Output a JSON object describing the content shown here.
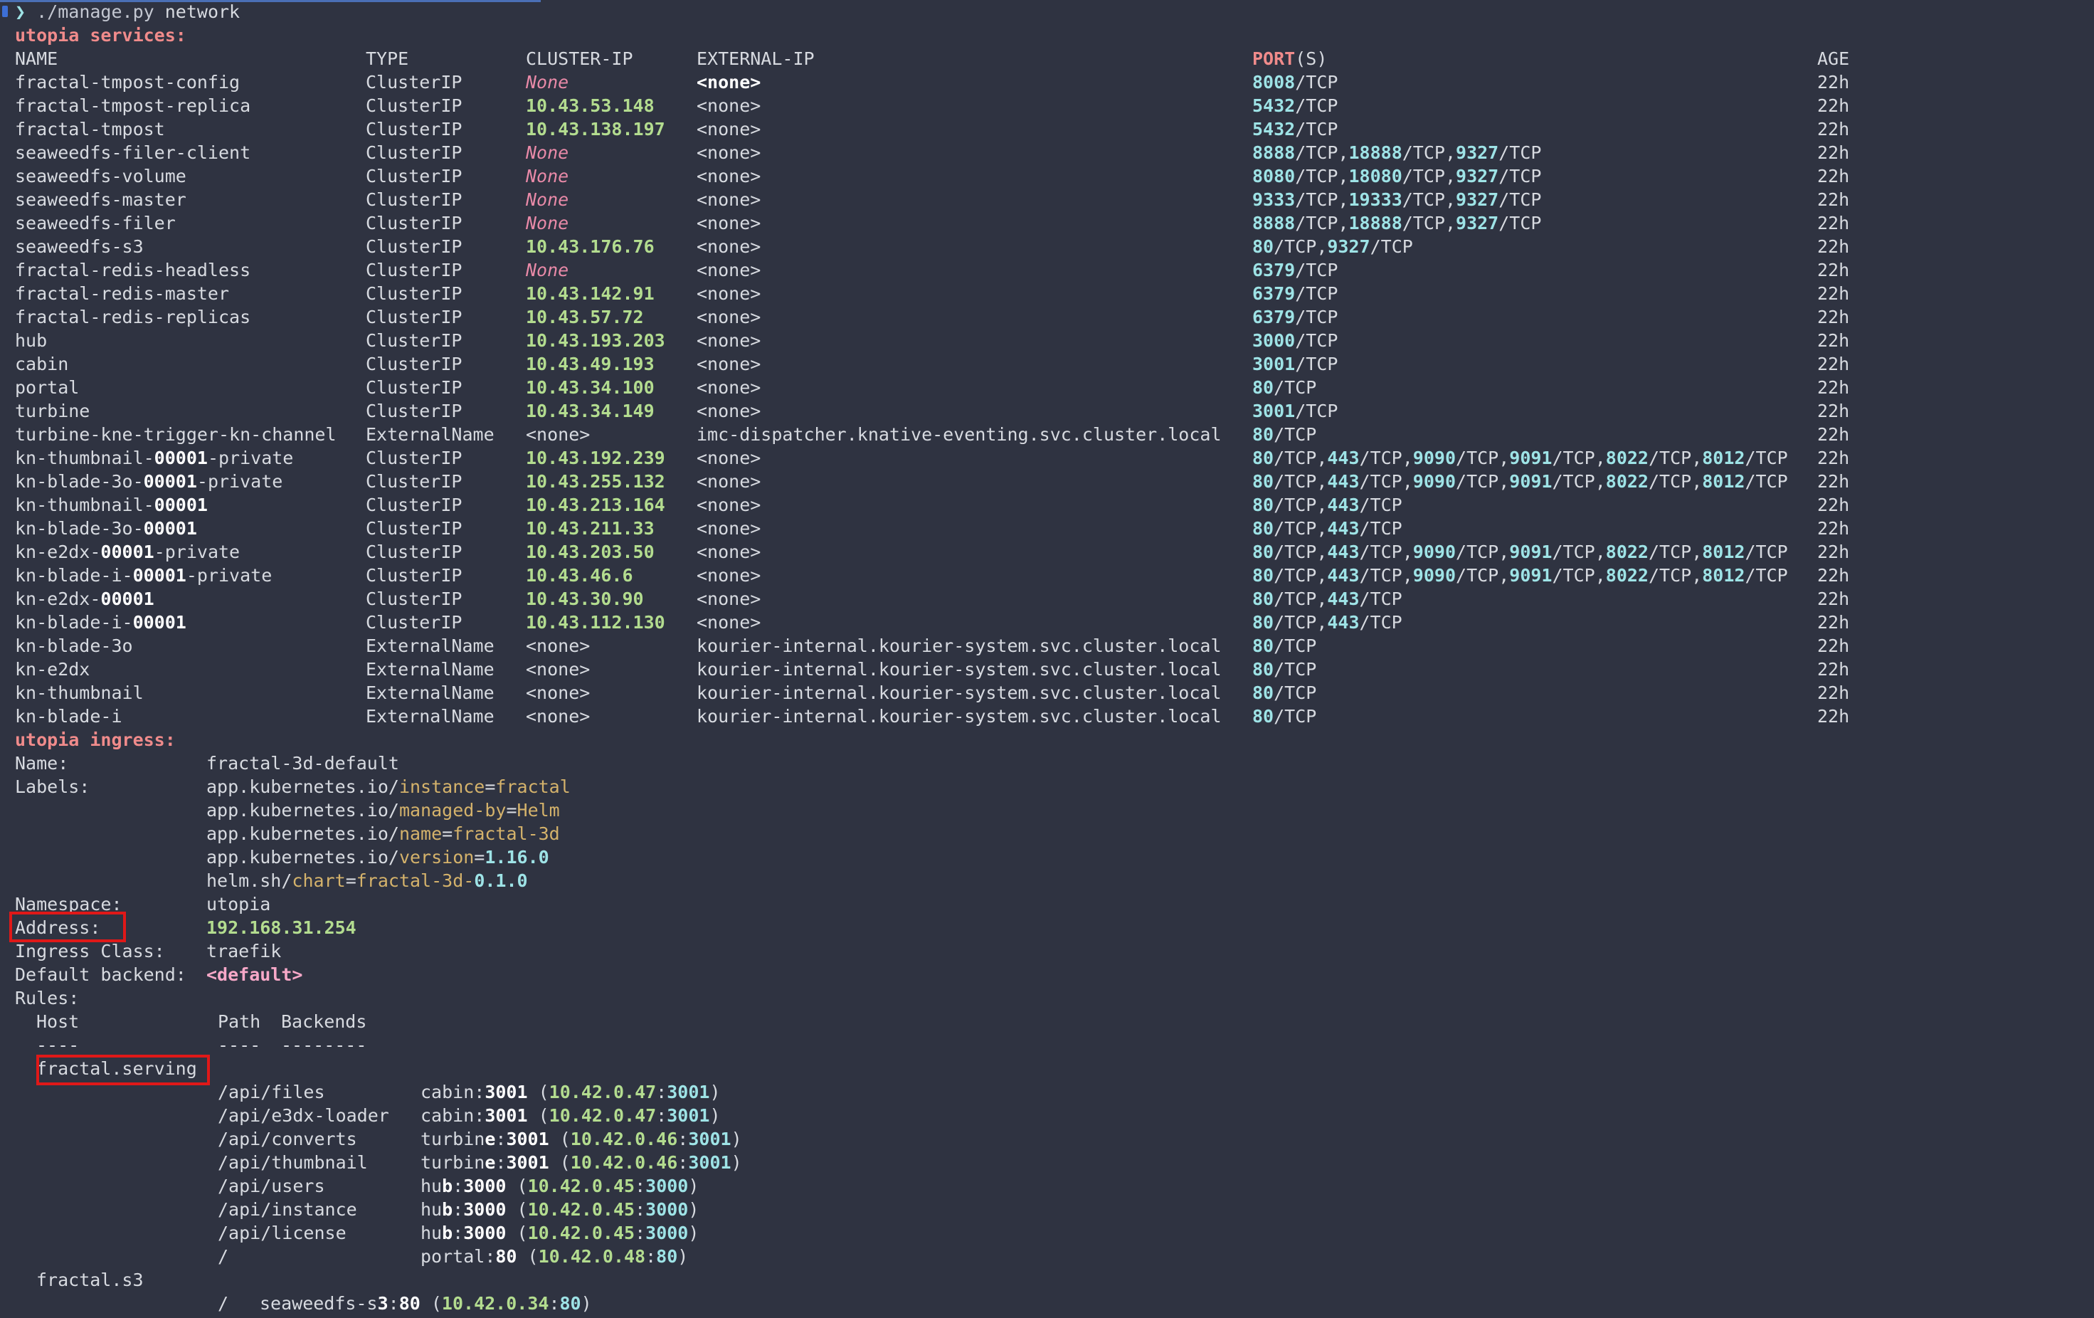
{
  "prompt": {
    "symbol": "❯",
    "command": "./manage.py",
    "arg": "network"
  },
  "services": {
    "title": "utopia services:",
    "headers": {
      "name": "NAME",
      "type": "TYPE",
      "cluster_ip": "CLUSTER-IP",
      "external_ip": "EXTERNAL-IP",
      "ports_bold": "PORT",
      "ports_rest": "(S)",
      "age": "AGE"
    },
    "rows": [
      {
        "name": "fractal-tmpost-config",
        "type": "ClusterIP",
        "cluster_ip": "None",
        "external_ip": "<none>",
        "ports": "8008/TCP",
        "age": "22h"
      },
      {
        "name": "fractal-tmpost-replica",
        "type": "ClusterIP",
        "cluster_ip": "10.43.53.148",
        "external_ip": "<none>",
        "ports": "5432/TCP",
        "age": "22h"
      },
      {
        "name": "fractal-tmpost",
        "type": "ClusterIP",
        "cluster_ip": "10.43.138.197",
        "external_ip": "<none>",
        "ports": "5432/TCP",
        "age": "22h"
      },
      {
        "name": "seaweedfs-filer-client",
        "type": "ClusterIP",
        "cluster_ip": "None",
        "external_ip": "<none>",
        "ports": "8888/TCP,18888/TCP,9327/TCP",
        "age": "22h"
      },
      {
        "name": "seaweedfs-volume",
        "type": "ClusterIP",
        "cluster_ip": "None",
        "external_ip": "<none>",
        "ports": "8080/TCP,18080/TCP,9327/TCP",
        "age": "22h"
      },
      {
        "name": "seaweedfs-master",
        "type": "ClusterIP",
        "cluster_ip": "None",
        "external_ip": "<none>",
        "ports": "9333/TCP,19333/TCP,9327/TCP",
        "age": "22h"
      },
      {
        "name": "seaweedfs-filer",
        "type": "ClusterIP",
        "cluster_ip": "None",
        "external_ip": "<none>",
        "ports": "8888/TCP,18888/TCP,9327/TCP",
        "age": "22h"
      },
      {
        "name": "seaweedfs-s3",
        "type": "ClusterIP",
        "cluster_ip": "10.43.176.76",
        "external_ip": "<none>",
        "ports": "80/TCP,9327/TCP",
        "age": "22h"
      },
      {
        "name": "fractal-redis-headless",
        "type": "ClusterIP",
        "cluster_ip": "None",
        "external_ip": "<none>",
        "ports": "6379/TCP",
        "age": "22h"
      },
      {
        "name": "fractal-redis-master",
        "type": "ClusterIP",
        "cluster_ip": "10.43.142.91",
        "external_ip": "<none>",
        "ports": "6379/TCP",
        "age": "22h"
      },
      {
        "name": "fractal-redis-replicas",
        "type": "ClusterIP",
        "cluster_ip": "10.43.57.72",
        "external_ip": "<none>",
        "ports": "6379/TCP",
        "age": "22h"
      },
      {
        "name": "hub",
        "type": "ClusterIP",
        "cluster_ip": "10.43.193.203",
        "external_ip": "<none>",
        "ports": "3000/TCP",
        "age": "22h"
      },
      {
        "name": "cabin",
        "type": "ClusterIP",
        "cluster_ip": "10.43.49.193",
        "external_ip": "<none>",
        "ports": "3001/TCP",
        "age": "22h"
      },
      {
        "name": "portal",
        "type": "ClusterIP",
        "cluster_ip": "10.43.34.100",
        "external_ip": "<none>",
        "ports": "80/TCP",
        "age": "22h"
      },
      {
        "name": "turbine",
        "type": "ClusterIP",
        "cluster_ip": "10.43.34.149",
        "external_ip": "<none>",
        "ports": "3001/TCP",
        "age": "22h"
      },
      {
        "name": "turbine-kne-trigger-kn-channel",
        "type": "ExternalName",
        "cluster_ip": "<none>",
        "external_ip": "imc-dispatcher.knative-eventing.svc.cluster.local",
        "ports": "80/TCP",
        "age": "22h"
      },
      {
        "name": "kn-thumbnail-00001-private",
        "type": "ClusterIP",
        "cluster_ip": "10.43.192.239",
        "external_ip": "<none>",
        "ports": "80/TCP,443/TCP,9090/TCP,9091/TCP,8022/TCP,8012/TCP",
        "age": "22h"
      },
      {
        "name": "kn-blade-3o-00001-private",
        "type": "ClusterIP",
        "cluster_ip": "10.43.255.132",
        "external_ip": "<none>",
        "ports": "80/TCP,443/TCP,9090/TCP,9091/TCP,8022/TCP,8012/TCP",
        "age": "22h"
      },
      {
        "name": "kn-thumbnail-00001",
        "type": "ClusterIP",
        "cluster_ip": "10.43.213.164",
        "external_ip": "<none>",
        "ports": "80/TCP,443/TCP",
        "age": "22h"
      },
      {
        "name": "kn-blade-3o-00001",
        "type": "ClusterIP",
        "cluster_ip": "10.43.211.33",
        "external_ip": "<none>",
        "ports": "80/TCP,443/TCP",
        "age": "22h"
      },
      {
        "name": "kn-e2dx-00001-private",
        "type": "ClusterIP",
        "cluster_ip": "10.43.203.50",
        "external_ip": "<none>",
        "ports": "80/TCP,443/TCP,9090/TCP,9091/TCP,8022/TCP,8012/TCP",
        "age": "22h"
      },
      {
        "name": "kn-blade-i-00001-private",
        "type": "ClusterIP",
        "cluster_ip": "10.43.46.6",
        "external_ip": "<none>",
        "ports": "80/TCP,443/TCP,9090/TCP,9091/TCP,8022/TCP,8012/TCP",
        "age": "22h"
      },
      {
        "name": "kn-e2dx-00001",
        "type": "ClusterIP",
        "cluster_ip": "10.43.30.90",
        "external_ip": "<none>",
        "ports": "80/TCP,443/TCP",
        "age": "22h"
      },
      {
        "name": "kn-blade-i-00001",
        "type": "ClusterIP",
        "cluster_ip": "10.43.112.130",
        "external_ip": "<none>",
        "ports": "80/TCP,443/TCP",
        "age": "22h"
      },
      {
        "name": "kn-blade-3o",
        "type": "ExternalName",
        "cluster_ip": "<none>",
        "external_ip": "kourier-internal.kourier-system.svc.cluster.local",
        "ports": "80/TCP",
        "age": "22h"
      },
      {
        "name": "kn-e2dx",
        "type": "ExternalName",
        "cluster_ip": "<none>",
        "external_ip": "kourier-internal.kourier-system.svc.cluster.local",
        "ports": "80/TCP",
        "age": "22h"
      },
      {
        "name": "kn-thumbnail",
        "type": "ExternalName",
        "cluster_ip": "<none>",
        "external_ip": "kourier-internal.kourier-system.svc.cluster.local",
        "ports": "80/TCP",
        "age": "22h"
      },
      {
        "name": "kn-blade-i",
        "type": "ExternalName",
        "cluster_ip": "<none>",
        "external_ip": "kourier-internal.kourier-system.svc.cluster.local",
        "ports": "80/TCP",
        "age": "22h"
      }
    ]
  },
  "ingress": {
    "title": "utopia ingress:",
    "name_label": "Name:",
    "name": "fractal-3d-default",
    "labels_label": "Labels:",
    "labels": [
      {
        "prefix": "app.kubernetes.io/",
        "key": "instance",
        "eq": "=",
        "value": "fractal"
      },
      {
        "prefix": "app.kubernetes.io/",
        "key": "managed-by",
        "eq": "=",
        "value": "Helm"
      },
      {
        "prefix": "app.kubernetes.io/",
        "key": "name",
        "eq": "=",
        "value": "fractal-3d"
      },
      {
        "prefix": "app.kubernetes.io/",
        "key": "version",
        "eq": "=",
        "value": "1.16.0"
      },
      {
        "prefix": "helm.sh/",
        "key": "chart",
        "eq": "=",
        "value": "fractal-3d-0.1.0"
      }
    ],
    "namespace_label": "Namespace:",
    "namespace": "utopia",
    "address_label": "Address:",
    "address": "192.168.31.254",
    "class_label": "Ingress Class:",
    "class": "traefik",
    "backend_label": "Default backend:",
    "backend": "<default>",
    "rules_label": "Rules:",
    "rules_headers": {
      "host": "Host",
      "path": "Path",
      "backends": "Backends"
    },
    "rules_dashes": {
      "host": "----",
      "path": "----",
      "backends": "--------"
    },
    "hosts": [
      {
        "host": "fractal.serving",
        "paths": [
          {
            "path": "/api/files",
            "svc": "cabin",
            "port": "3001",
            "ip": "10.42.0.47",
            "ipport": "3001"
          },
          {
            "path": "/api/e3dx-loader",
            "svc": "cabin",
            "port": "3001",
            "ip": "10.42.0.47",
            "ipport": "3001"
          },
          {
            "path": "/api/converts",
            "svc": "turbine",
            "port": "3001",
            "ip": "10.42.0.46",
            "ipport": "3001"
          },
          {
            "path": "/api/thumbnail",
            "svc": "turbine",
            "port": "3001",
            "ip": "10.42.0.46",
            "ipport": "3001"
          },
          {
            "path": "/api/users",
            "svc": "hub",
            "port": "3000",
            "ip": "10.42.0.45",
            "ipport": "3000"
          },
          {
            "path": "/api/instance",
            "svc": "hub",
            "port": "3000",
            "ip": "10.42.0.45",
            "ipport": "3000"
          },
          {
            "path": "/api/license",
            "svc": "hub",
            "port": "3000",
            "ip": "10.42.0.45",
            "ipport": "3000"
          },
          {
            "path": "/",
            "svc": "portal",
            "port": "80",
            "ip": "10.42.0.48",
            "ipport": "80"
          }
        ]
      },
      {
        "host": "fractal.s3",
        "paths": [
          {
            "path": "/",
            "svc": "seaweedfs-s3",
            "port": "80",
            "ip": "10.42.0.34",
            "ipport": "80"
          }
        ]
      }
    ]
  }
}
